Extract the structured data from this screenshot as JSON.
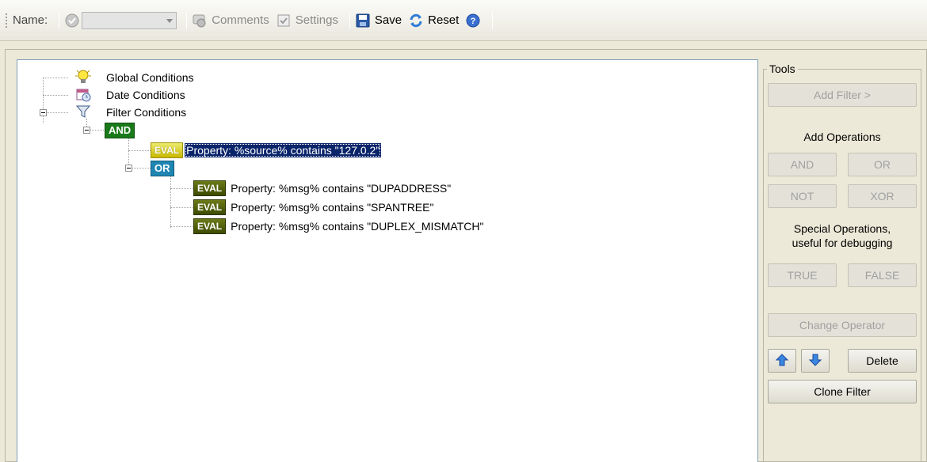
{
  "toolbar": {
    "name_label": "Name:",
    "name_value": "",
    "comments_label": "Comments",
    "settings_label": "Settings",
    "save_label": "Save",
    "reset_label": "Reset"
  },
  "tree": {
    "global": "Global Conditions",
    "date": "Date Conditions",
    "filter": "Filter Conditions",
    "and_label": "AND",
    "or_label": "OR",
    "eval_label": "EVAL",
    "eval1": "Property: %source% contains \"127.0.2\"",
    "eval2": "Property: %msg% contains \"DUPADDRESS\"",
    "eval3": "Property: %msg% contains \"SPANTREE\"",
    "eval4": "Property: %msg% contains \"DUPLEX_MISMATCH\""
  },
  "tools": {
    "title": "Tools",
    "add_filter": "Add Filter >",
    "add_operations": "Add Operations",
    "and": "AND",
    "or": "OR",
    "not": "NOT",
    "xor": "XOR",
    "special_line1": "Special Operations,",
    "special_line2": "useful for debugging",
    "true": "TRUE",
    "false": "FALSE",
    "change_operator": "Change Operator",
    "delete": "Delete",
    "clone_filter": "Clone Filter"
  }
}
